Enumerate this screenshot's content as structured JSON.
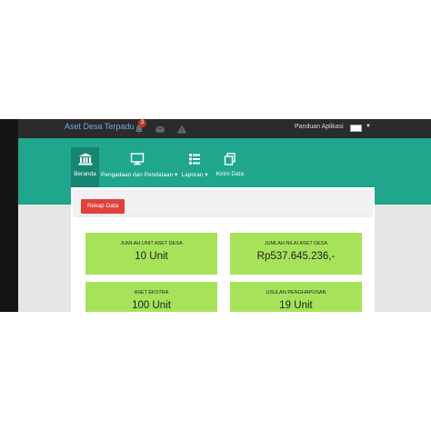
{
  "navbar": {
    "brand": "Aset Desa Terpadu",
    "notification_count": "3",
    "guide_link": "Panduan Aplikasi"
  },
  "menu": [
    {
      "label": "Beranda",
      "icon": "bank-icon"
    },
    {
      "label": "Pengadaan dan Pendataan",
      "icon": "monitor-icon",
      "dropdown": true
    },
    {
      "label": "Laporan",
      "icon": "list-icon",
      "dropdown": true
    },
    {
      "label": "Kirim Data",
      "icon": "copy-icon"
    }
  ],
  "panel": {
    "rekap_button": "Rekap Data"
  },
  "cards": [
    {
      "title": "JUMLAH UNIT ASET DESA",
      "value": "10 Unit"
    },
    {
      "title": "JUMLAH NILAI ASET DESA",
      "value": "Rp537.645.236,-"
    },
    {
      "title": "ASET EKSTRA",
      "value": "100 Unit"
    },
    {
      "title": "USULAN PENGHAPUSAN",
      "value": "19 Unit"
    }
  ],
  "colors": {
    "navbar": "#2b2b2b",
    "menubar": "#1fa68c",
    "active_menu": "#178572",
    "card": "#a6e35a",
    "button": "#e0413a"
  }
}
